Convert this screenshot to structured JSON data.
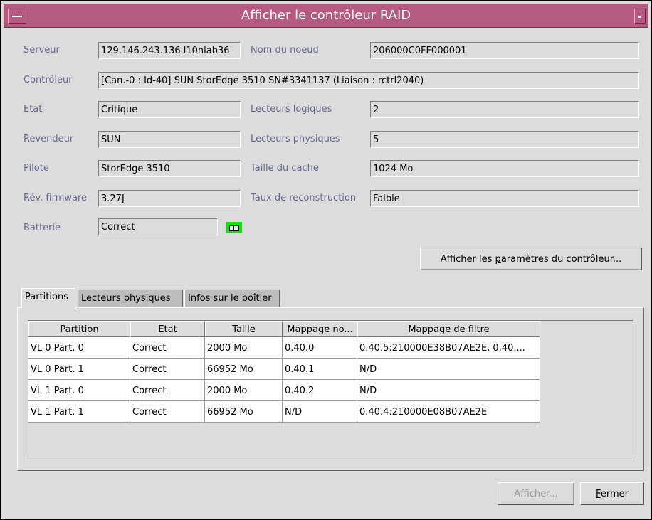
{
  "window": {
    "title": "Afficher le contrôleur RAID"
  },
  "fields": {
    "serveur": {
      "label": "Serveur",
      "value": "129.146.243.136 l10nlab36"
    },
    "nom_noeud": {
      "label": "Nom du noeud",
      "value": "206000C0FF000001"
    },
    "controleur": {
      "label": "Contrôleur",
      "value": "[Can.-0 : Id-40] SUN StorEdge 3510 SN#3341137  (Liaison : rctrl2040)"
    },
    "etat": {
      "label": "Etat",
      "value": "Critique"
    },
    "lecteurs_logiques": {
      "label": "Lecteurs logiques",
      "value": "2"
    },
    "revendeur": {
      "label": "Revendeur",
      "value": "SUN"
    },
    "lecteurs_physiques": {
      "label": "Lecteurs physiques",
      "value": "5"
    },
    "pilote": {
      "label": "Pilote",
      "value": "StorEdge 3510"
    },
    "taille_cache": {
      "label": "Taille du cache",
      "value": "1024 Mo"
    },
    "rev_firmware": {
      "label": "Rév. firmware",
      "value": "3.27J"
    },
    "taux_reconstruction": {
      "label": "Taux de reconstruction",
      "value": "Faible"
    },
    "batterie": {
      "label": "Batterie",
      "value": "Correct"
    }
  },
  "buttons": {
    "params_pre": "Afficher les ",
    "params_u": "p",
    "params_post": "aramètres du contrôleur...",
    "afficher": "Afficher...",
    "fermer_u": "F",
    "fermer_post": "ermer"
  },
  "tabs": [
    "Partitions",
    "Lecteurs physiques",
    "Infos sur le boîtier"
  ],
  "table": {
    "columns": [
      "Partition",
      "Etat",
      "Taille",
      "Mappage no...",
      "Mappage de filtre"
    ],
    "rows": [
      [
        "VL 0 Part. 0",
        "Correct",
        "2000 Mo",
        "0.40.0",
        "0.40.5:210000E38B07AE2E, 0.40...."
      ],
      [
        "VL 0 Part. 1",
        "Correct",
        "66952 Mo",
        "0.40.1",
        "N/D"
      ],
      [
        "VL 1 Part. 0",
        "Correct",
        "2000 Mo",
        "0.40.2",
        "N/D"
      ],
      [
        "VL 1 Part. 1",
        "Correct",
        "66952 Mo",
        "N/D",
        "0.40.4:210000E08B07AE2E"
      ]
    ]
  },
  "icons": {
    "window_menu": "window-menu-icon",
    "minimize": "minimize-icon",
    "battery": "battery-status-icon"
  },
  "colors": {
    "titlebar": "#b65a80",
    "label": "#686890",
    "battery_ok": "#10e010"
  }
}
